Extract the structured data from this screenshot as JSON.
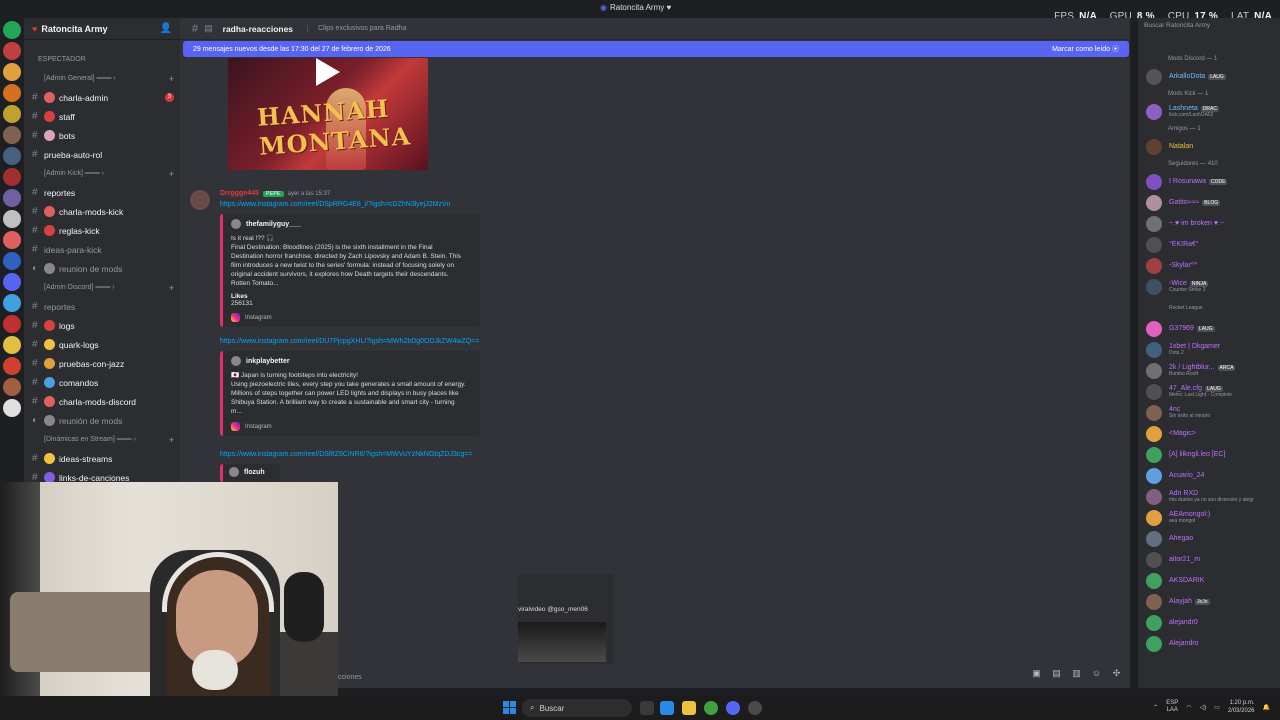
{
  "window": {
    "title": "Ratoncita Army"
  },
  "overlay": {
    "fps_label": "FPS",
    "fps_value": "N/A",
    "gpu_label": "GPU",
    "gpu_value": "8 %",
    "cpu_label": "CPU",
    "cpu_value": "17 %",
    "lat_label": "LAT",
    "lat_value": "N/A"
  },
  "server": {
    "name": "Ratoncita Army"
  },
  "sidebar": {
    "spectator": "ESPECTADOR",
    "items": [
      {
        "type": "cat",
        "label": "[Admin General] ═══ ›"
      },
      {
        "type": "ch",
        "label": "charla-admin",
        "unread": true,
        "badge": "3",
        "color": "#e06060"
      },
      {
        "type": "ch",
        "label": "staff",
        "unread": true,
        "color": "#d94040"
      },
      {
        "type": "ch",
        "label": "bots",
        "unread": true,
        "color": "#e0a0c0"
      },
      {
        "type": "ch",
        "label": "prueba-auto-rol",
        "unread": true,
        "color": ""
      },
      {
        "type": "cat",
        "label": "[Admin Kick] ═══ ›"
      },
      {
        "type": "ch",
        "label": "reportes",
        "unread": true,
        "color": ""
      },
      {
        "type": "ch",
        "label": "charla-mods-kick",
        "unread": true,
        "color": "#e06060"
      },
      {
        "type": "ch",
        "label": "reglas-kick",
        "unread": true,
        "color": "#d94040"
      },
      {
        "type": "ch",
        "label": "ideas-para-kick",
        "unread": false,
        "color": ""
      },
      {
        "type": "voice",
        "label": "reunion de mods",
        "unread": false,
        "color": "#888"
      },
      {
        "type": "cat",
        "label": "[Admin Discord] ═══ ›"
      },
      {
        "type": "ch",
        "label": "reportes",
        "unread": false,
        "color": ""
      },
      {
        "type": "ch",
        "label": "logs",
        "unread": true,
        "color": "#d94040"
      },
      {
        "type": "ch",
        "label": "quark-logs",
        "unread": true,
        "color": "#f0c040"
      },
      {
        "type": "ch",
        "label": "pruebas-con-jazz",
        "unread": true,
        "color": "#e0a040"
      },
      {
        "type": "ch",
        "label": "comandos",
        "unread": true,
        "color": "#4aa0e0"
      },
      {
        "type": "ch",
        "label": "charla-mods-discord",
        "unread": true,
        "color": "#e06060"
      },
      {
        "type": "voice",
        "label": "reunión de mods",
        "unread": false,
        "color": "#888"
      },
      {
        "type": "cat",
        "label": "[Dinámicas en Stream] ═══ ›"
      },
      {
        "type": "ch",
        "label": "ideas-streams",
        "unread": true,
        "color": "#f0c040"
      },
      {
        "type": "ch",
        "label": "links-de-canciones",
        "unread": true,
        "color": "#8060e0"
      }
    ]
  },
  "chat": {
    "channel": "radha-reacciones",
    "topic": "Clips exclusivos para Radha",
    "new_messages": "29 mensajes nuevos desde las 17:30 del 27 de febrero de 2026",
    "mark_read": "Marcar como leído",
    "video_title": "HANNAH MONTANA",
    "message": {
      "author": "Drrggge445",
      "role": "PEPE",
      "time": "ayer a las 15:37",
      "link1": "https://www.instagram.com/reel/DSpRRG4E8_i/?igsh=cDZhN3lyejJ2MzVn",
      "embed1": {
        "author": "thefamilyguy___",
        "desc": [
          "Is it real !?? 🎧",
          "Final Destination: Bloodlines (2025) is the sixth installment in the Final",
          "Destination horror franchise, directed by Zach Lipovsky and Adam B. Stein. This",
          "film introduces a new twist to the series' formula: instead of focusing solely on",
          "original accident survivors, it explores how Death targets their descendants.",
          "Rotten Tomato..."
        ],
        "field_name": "Likes",
        "field_value": "256131",
        "footer": "Instagram"
      },
      "link2": "https://www.instagram.com/reel/DU7PjcpgXHL/?igsh=MWh2bDg0ODJkZW4wZQ==",
      "embed2": {
        "author": "inkplaybetter",
        "desc": [
          "🇯🇵 Japan is turning footsteps into electricity!",
          "Using piezoelectric tiles, every step you take generates a small amount of energy.",
          "Millions of steps together can power LED lights and displays in busy places like",
          "Shibuya Station. A brilliant way to create a sustainable and smart city - turning",
          "m..."
        ],
        "footer": "Instagram"
      },
      "link3": "https://www.instagram.com/reel/DSf8Z6CiNR6/?igsh=MWVuYzNkNGtqZDJ3cg==",
      "embed3_author": "flozuh",
      "embed4_caption": "viralvideo @gso_men06",
      "bottom_text": "cciones"
    }
  },
  "members": {
    "search_placeholder": "Buscar Ratoncita Army",
    "sections": [
      {
        "title": "Mods Discord — 1",
        "members": [
          {
            "name": "ArkalloDota",
            "tag": "LAUG",
            "color": "#7ab8ff",
            "sub": "",
            "av": "#555"
          }
        ]
      },
      {
        "title": "Mods Kick — 1",
        "members": [
          {
            "name": "Lashneta",
            "tag": "DRAC",
            "color": "#7ab8ff",
            "sub": "kick.com/LashOA52",
            "av": "#9060c0"
          }
        ]
      },
      {
        "title": "Amigos — 1",
        "members": [
          {
            "name": "Natalan",
            "tag": "",
            "color": "#f0c040",
            "sub": "",
            "av": "#604030"
          }
        ]
      },
      {
        "title": "Seguidores — 410",
        "members": [
          {
            "name": "I Rosunawa",
            "tag": "CODE",
            "color": "#c070ff",
            "sub": "",
            "av": "#8050c0"
          },
          {
            "name": "Gatito≈≈≈",
            "tag": "BLOG",
            "color": "#c070ff",
            "sub": "",
            "av": "#b090a0"
          },
          {
            "name": "~.♥ im broken ♥.~",
            "tag": "",
            "color": "#c070ff",
            "sub": "",
            "av": "#707070"
          },
          {
            "name": "°EKIRa€°",
            "tag": "",
            "color": "#c070ff",
            "sub": "",
            "av": "#505050"
          },
          {
            "name": "-Skylar^^",
            "tag": "",
            "color": "#c070ff",
            "sub": "",
            "av": "#a04040"
          },
          {
            "name": "-Wice",
            "tag": "NINJA",
            "color": "#c070ff",
            "sub": "Counter-Strike 2",
            "av": "#405060"
          },
          {
            "name": "",
            "tag": "",
            "color": "#c070ff",
            "sub": "Rocket League",
            "av": ""
          },
          {
            "name": "G37969",
            "tag": "LAUG",
            "color": "#c070ff",
            "sub": "",
            "av": "#e060c0"
          },
          {
            "name": "1xbet | Dkgamer",
            "tag": "",
            "color": "#c070ff",
            "sub": "Dota 2",
            "av": "#406080"
          },
          {
            "name": "2k / Lightblur...",
            "tag": "ARCA",
            "color": "#c070ff",
            "sub": "Bumbo Rooft",
            "av": "#707070"
          },
          {
            "name": "47_Ale.cfg",
            "tag": "LAUG",
            "color": "#c070ff",
            "sub": "Metro: Last Light - Complete",
            "av": "#505050"
          },
          {
            "name": "4nc",
            "tag": "",
            "color": "#c070ff",
            "sub": "Sin éxito al mirarlo",
            "av": "#806050"
          },
          {
            "name": "<Magic>",
            "tag": "",
            "color": "#c070ff",
            "sub": "",
            "av": "#e0a040"
          },
          {
            "name": "[A] lilkngli.leo [EC]",
            "tag": "",
            "color": "#c070ff",
            "sub": "",
            "av": "#40a060"
          },
          {
            "name": "Acuario_24",
            "tag": "",
            "color": "#c070ff",
            "sub": "",
            "av": "#60a0e0"
          },
          {
            "name": "Adri RXD",
            "tag": "",
            "color": "#c070ff",
            "sub": "mis duelos ya no son diversión y alegr",
            "av": "#806080"
          },
          {
            "name": "AEAmongol:)",
            "tag": "",
            "color": "#c070ff",
            "sub": "aea mongol",
            "av": "#e0a040"
          },
          {
            "name": "Ahegao",
            "tag": "",
            "color": "#c070ff",
            "sub": "",
            "av": "#607080"
          },
          {
            "name": "aitor21_m",
            "tag": "",
            "color": "#c070ff",
            "sub": "",
            "av": "#505050"
          },
          {
            "name": "AKSDARIK",
            "tag": "",
            "color": "#c070ff",
            "sub": "",
            "av": "#40a060"
          },
          {
            "name": "Alayjah",
            "tag": "JoJo",
            "color": "#c070ff",
            "sub": "",
            "av": "#806050"
          },
          {
            "name": "alejandr0",
            "tag": "",
            "color": "#c070ff",
            "sub": "",
            "av": "#40a060"
          },
          {
            "name": "Alejandro",
            "tag": "",
            "color": "#c070ff",
            "sub": "",
            "av": "#40a060"
          }
        ]
      }
    ]
  },
  "taskbar": {
    "search": "Buscar",
    "lang1": "ESP",
    "lang2": "LAA",
    "time": "1:20 p.m.",
    "date": "2/03/2026"
  }
}
